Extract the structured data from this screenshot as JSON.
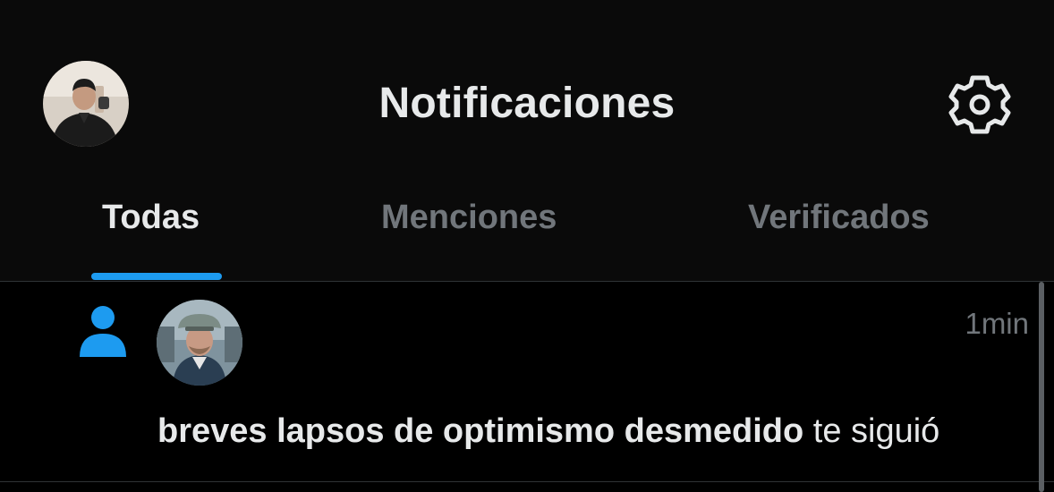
{
  "header": {
    "title": "Notificaciones",
    "avatar_icon": "user-avatar",
    "settings_icon": "gear-icon"
  },
  "tabs": [
    {
      "label": "Todas",
      "active": true
    },
    {
      "label": "Menciones",
      "active": false
    },
    {
      "label": "Verificados",
      "active": false
    }
  ],
  "notifications": [
    {
      "type": "follow",
      "icon": "person-icon",
      "user_name": "breves lapsos de optimismo desmedido",
      "action_text": " te siguió",
      "time": "1min"
    }
  ],
  "colors": {
    "accent": "#1d9bf0",
    "background": "#000000",
    "header_background": "#0a0a0a",
    "text_primary": "#e7e9ea",
    "text_secondary": "#71767b",
    "divider": "#2f3336"
  }
}
